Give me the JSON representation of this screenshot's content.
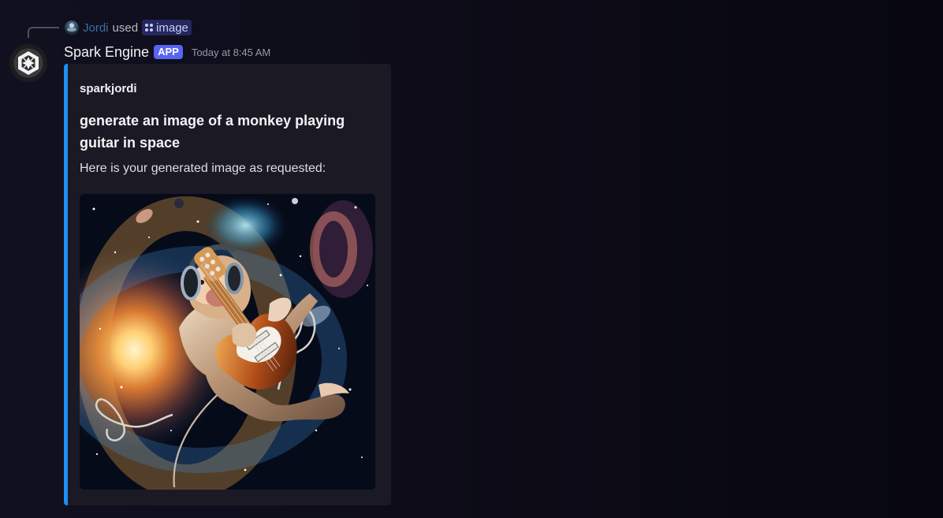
{
  "reply": {
    "user": "Jordi",
    "used": "used",
    "command": "image",
    "icon": "command-icon"
  },
  "message": {
    "author": "Spark Engine",
    "badge": "APP",
    "timestamp": "Today at 8:45 AM"
  },
  "embed": {
    "author": "sparkjordi",
    "title": "generate an image of a monkey playing guitar in space",
    "description": "Here is your generated image as requested:",
    "accent_color": "#1d8ff2"
  },
  "colors": {
    "background": "#0d0c18",
    "badge": "#5865f2",
    "embed_background": "#1b1a24"
  }
}
